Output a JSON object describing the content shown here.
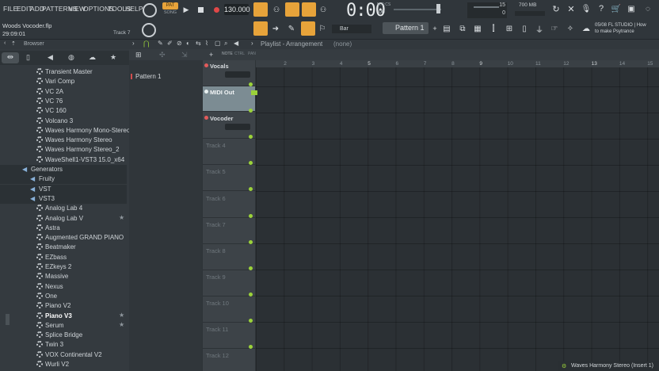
{
  "menu": [
    "FILE",
    "EDIT",
    "ADD",
    "PATTERNS",
    "VIEW",
    "OPTIONS",
    "TOOLS",
    "HELP"
  ],
  "transport": {
    "pat_song": "PAT",
    "song": "SONG",
    "tempo": "130.000",
    "time": "0:00",
    "time_unit": "M:S:CS",
    "time_sub": "00"
  },
  "meters": {
    "cpu": "15",
    "mem": "700 MB",
    "voices": "0"
  },
  "project": {
    "filename": "Woods Vocoder.flp",
    "elapsed": "29:09:01",
    "track_hint": "Track 7"
  },
  "pattern_selector": {
    "label": "Pattern 1"
  },
  "snap": {
    "label": "Bar"
  },
  "news": {
    "date": "05/08",
    "line1": "FL STUDIO | How",
    "line2": "to make Psytrance"
  },
  "browser": {
    "title": "Browser",
    "items": [
      {
        "label": "Transient Master",
        "star": false
      },
      {
        "label": "Vari Comp",
        "star": false
      },
      {
        "label": "VC 2A",
        "star": false
      },
      {
        "label": "VC 76",
        "star": false
      },
      {
        "label": "VC 160",
        "star": false
      },
      {
        "label": "Volcano 3",
        "star": false
      },
      {
        "label": "Waves Harmony Mono-Stereo",
        "star": false
      },
      {
        "label": "Waves Harmony Stereo",
        "star": false
      },
      {
        "label": "Waves Harmony Stereo_2",
        "star": false
      },
      {
        "label": "WaveShell1-VST3 15.0_x64",
        "star": false
      }
    ],
    "generators": "Generators",
    "gen_folders": [
      "Fruity",
      "VST",
      "VST3"
    ],
    "vst3_items": [
      {
        "label": "Analog Lab 4",
        "star": false
      },
      {
        "label": "Analog Lab V",
        "star": true
      },
      {
        "label": "Astra",
        "star": false
      },
      {
        "label": "Augmented GRAND PIANO",
        "star": false
      },
      {
        "label": "Beatmaker",
        "star": false
      },
      {
        "label": "EZbass",
        "star": false
      },
      {
        "label": "EZkeys 2",
        "star": false
      },
      {
        "label": "Massive",
        "star": false
      },
      {
        "label": "Nexus",
        "star": false
      },
      {
        "label": "One",
        "star": false
      },
      {
        "label": "Piano V2",
        "star": false
      },
      {
        "label": "Piano V3",
        "star": true
      },
      {
        "label": "Serum",
        "star": true
      },
      {
        "label": "Splice Bridge",
        "star": false
      },
      {
        "label": "Twin 3",
        "star": false
      },
      {
        "label": "VOX Continental V2",
        "star": false
      },
      {
        "label": "Wurli V2",
        "star": false
      }
    ]
  },
  "playlist": {
    "title": "Playlist - Arrangement",
    "sub": "(none)",
    "patterns": [
      "Pattern 1"
    ],
    "tracks": [
      "Vocals",
      "MIDI Out",
      "Vocoder",
      "Track 4",
      "Track 5",
      "Track 6",
      "Track 7",
      "Track 8",
      "Track 9",
      "Track 10",
      "Track 11",
      "Track 12"
    ],
    "ruler": [
      "2",
      "3",
      "4",
      "5",
      "6",
      "7",
      "8",
      "9",
      "10",
      "11",
      "12",
      "13",
      "14",
      "15"
    ]
  },
  "status": {
    "text": "Waves Harmony Stereo (Insert 1)"
  }
}
